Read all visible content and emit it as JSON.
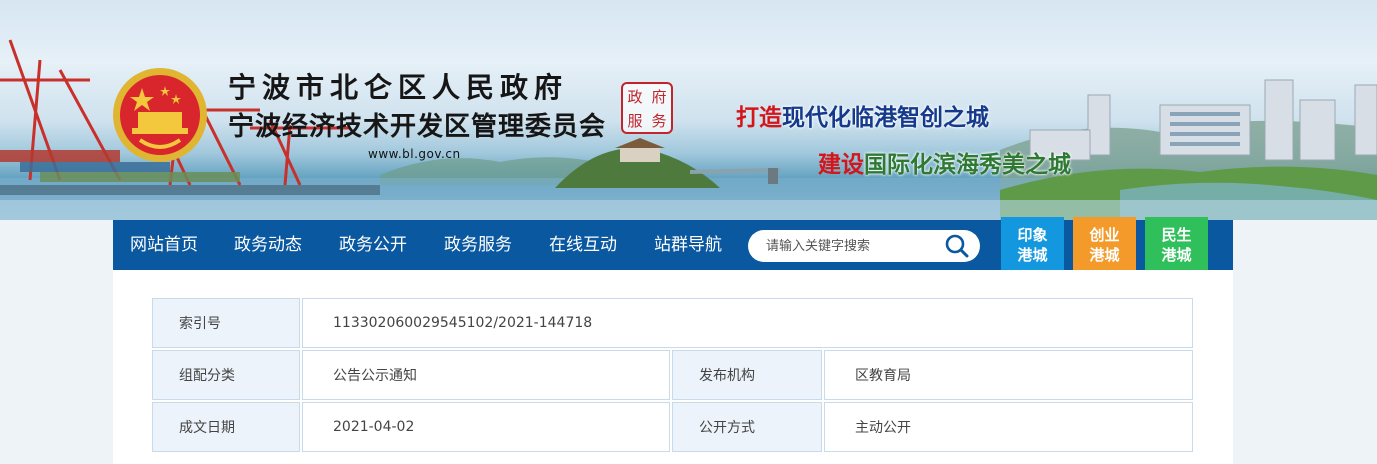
{
  "header": {
    "org_name_1": "宁波市北仑区人民政府",
    "org_name_2": "宁波经济技术开发区管理委员会",
    "url": "www.bl.gov.cn",
    "seal_chars": [
      "政",
      "府",
      "服",
      "务"
    ],
    "slogan_1": {
      "highlight": "打造",
      "rest": "现代化临港智创之城"
    },
    "slogan_2": {
      "highlight": "建设",
      "rest": "国际化滨海秀美之城"
    }
  },
  "nav": {
    "items": [
      {
        "label": "网站首页"
      },
      {
        "label": "政务动态"
      },
      {
        "label": "政务公开"
      },
      {
        "label": "政务服务"
      },
      {
        "label": "在线互动"
      },
      {
        "label": "站群导航"
      }
    ],
    "search_placeholder": "请输入关键字搜索",
    "tiles": [
      {
        "line1": "印象",
        "line2": "港城",
        "color": "#1398e0"
      },
      {
        "line1": "创业",
        "line2": "港城",
        "color": "#f39a2b"
      },
      {
        "line1": "民生",
        "line2": "港城",
        "color": "#2fbf5b"
      }
    ],
    "bar_color": "#0a58a0"
  },
  "info": {
    "index_label": "索引号",
    "index_value": "113302060029545102/2021-144718",
    "category_label": "组配分类",
    "category_value": "公告公示通知",
    "publisher_label": "发布机构",
    "publisher_value": "区教育局",
    "date_label": "成文日期",
    "date_value": "2021-04-02",
    "disclosure_label": "公开方式",
    "disclosure_value": "主动公开"
  }
}
